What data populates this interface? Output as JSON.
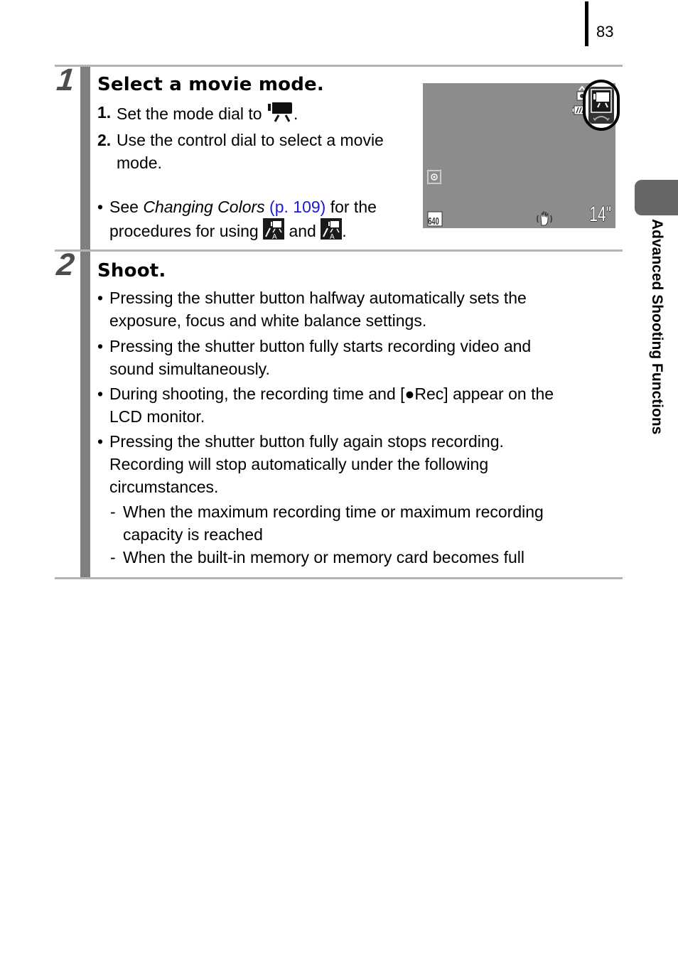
{
  "page_number": "83",
  "side_tab": {
    "label": "Advanced Shooting Functions"
  },
  "steps": [
    {
      "number": "1",
      "heading": "Select a movie mode.",
      "numbered_items": [
        {
          "num": "1.",
          "text_before_icon": "Set the mode dial to ",
          "icon": "movie-mode-icon",
          "text_after_icon": "."
        },
        {
          "num": "2.",
          "line1": "Use the control dial to select a movie",
          "line2": "mode."
        }
      ],
      "note": {
        "bullet": "•",
        "pre": "See ",
        "italic": "Changing Colors",
        "link": "(p. 109)",
        "post": " for the",
        "line2_pre": "procedures for using ",
        "icon1": "color-accent-movie-icon",
        "mid": " and ",
        "icon2": "color-swap-movie-icon",
        "end": "."
      },
      "lcd": {
        "icons": [
          "camera-mode-icon",
          "battery-icon",
          "movie-mode-dial-icon",
          "metering-icon",
          "resolution-640-icon",
          "image-stabilizer-icon"
        ],
        "resolution": "640",
        "remaining_time": "14\""
      }
    },
    {
      "number": "2",
      "heading": "Shoot.",
      "bullets": [
        {
          "mark": "•",
          "lines": [
            "Pressing the shutter button halfway automatically sets the",
            "exposure, focus and white balance settings."
          ]
        },
        {
          "mark": "•",
          "lines": [
            "Pressing the shutter button fully starts recording video and",
            "sound simultaneously."
          ]
        },
        {
          "mark": "•",
          "lines": [
            "During shooting, the recording time and [●Rec] appear on the",
            "LCD monitor."
          ]
        },
        {
          "mark": "•",
          "lines": [
            "Pressing the shutter button fully again stops recording.",
            "Recording will stop automatically under the following",
            "circumstances."
          ]
        }
      ],
      "sub_items": [
        {
          "mark": "-",
          "lines": [
            "When the maximum recording time or maximum recording",
            "capacity is reached"
          ]
        },
        {
          "mark": "-",
          "lines": [
            "When the built-in memory or memory card becomes full"
          ]
        }
      ]
    }
  ],
  "colors": {
    "link": "#1a1adc",
    "rule": "#b3b3b3",
    "step_bar": "#7f7f7f",
    "lcd_bg": "#8c8c8c"
  }
}
